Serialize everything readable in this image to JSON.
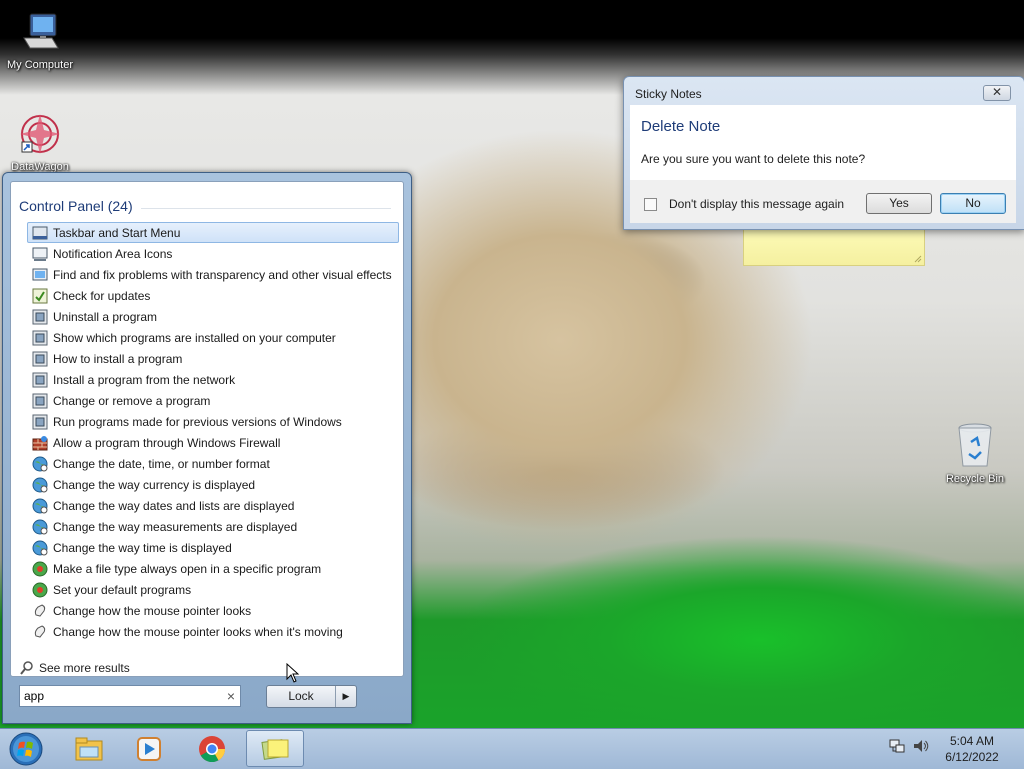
{
  "desktop": {
    "icons": [
      {
        "label": "My Computer"
      },
      {
        "label": "DataWagon"
      },
      {
        "label": "Recycle Bin"
      }
    ]
  },
  "start_menu": {
    "results_header": "Control Panel (24)",
    "results": [
      {
        "label": "Taskbar and Start Menu",
        "icon": "taskbar-icon",
        "selected": true
      },
      {
        "label": "Notification Area Icons",
        "icon": "notification-icon"
      },
      {
        "label": "Find and fix problems with transparency and other visual effects",
        "icon": "troubleshoot-icon"
      },
      {
        "label": "Check for updates",
        "icon": "windows-update-icon"
      },
      {
        "label": "Uninstall a program",
        "icon": "programs-icon"
      },
      {
        "label": "Show which programs are installed on your computer",
        "icon": "programs-icon"
      },
      {
        "label": "How to install a program",
        "icon": "programs-icon"
      },
      {
        "label": "Install a program from the network",
        "icon": "programs-icon"
      },
      {
        "label": "Change or remove a program",
        "icon": "programs-icon"
      },
      {
        "label": "Run programs made for previous versions of Windows",
        "icon": "programs-icon"
      },
      {
        "label": "Allow a program through Windows Firewall",
        "icon": "firewall-icon"
      },
      {
        "label": "Change the date, time, or number format",
        "icon": "region-icon"
      },
      {
        "label": "Change the way currency is displayed",
        "icon": "region-icon"
      },
      {
        "label": "Change the way dates and lists are displayed",
        "icon": "region-icon"
      },
      {
        "label": "Change the way measurements are displayed",
        "icon": "region-icon"
      },
      {
        "label": "Change the way time is displayed",
        "icon": "region-icon"
      },
      {
        "label": "Make a file type always open in a specific program",
        "icon": "default-programs-icon"
      },
      {
        "label": "Set your default programs",
        "icon": "default-programs-icon"
      },
      {
        "label": "Change how the mouse pointer looks",
        "icon": "mouse-icon"
      },
      {
        "label": "Change how the mouse pointer looks when it's moving",
        "icon": "mouse-icon"
      }
    ],
    "see_more": "See more results",
    "search_value": "app",
    "lock_label": "Lock"
  },
  "dialog": {
    "title": "Sticky Notes",
    "heading": "Delete Note",
    "message": "Are you sure you want to delete this note?",
    "checkbox_label": "Don't display this message again",
    "checkbox_checked": false,
    "yes_label": "Yes",
    "no_label": "No"
  },
  "taskbar": {
    "items": [
      "windows-explorer",
      "windows-media-player",
      "google-chrome",
      "sticky-notes"
    ],
    "active_item": "sticky-notes",
    "time": "5:04 AM",
    "date": "6/12/2022"
  },
  "colors": {
    "accent": "#1e3c78",
    "selection": "#cfe2f8",
    "taskbar": "#b9cde4"
  }
}
